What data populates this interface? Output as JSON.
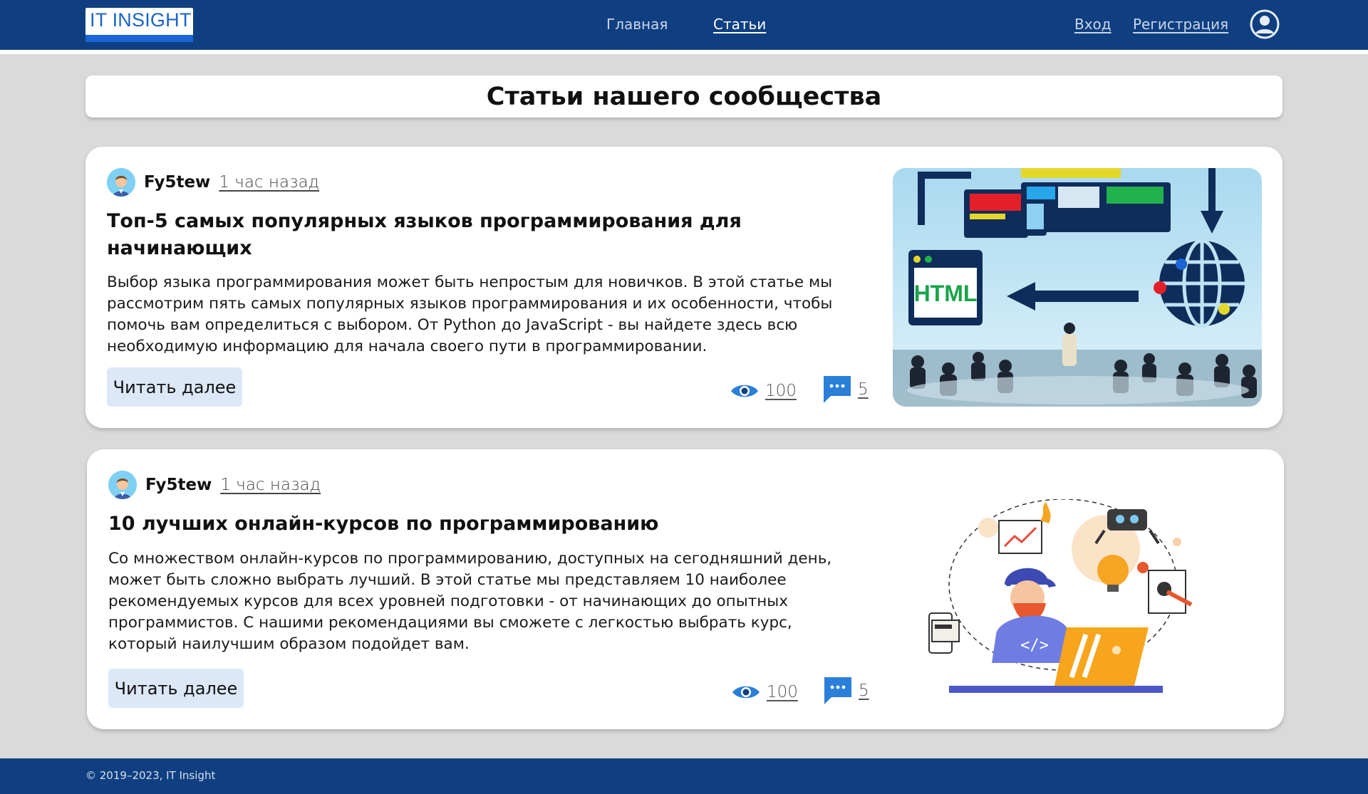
{
  "header": {
    "logo_text": "IT INSIGHT",
    "nav": {
      "home": "Главная",
      "articles": "Статьи"
    },
    "auth": {
      "login": "Вход",
      "register": "Регистрация"
    }
  },
  "page_title": "Статьи нашего сообщества",
  "articles": [
    {
      "author": "Fy5tew",
      "time": "1 час назад",
      "title": "Топ-5 самых популярных языков программирования для начинающих",
      "text": "Выбор языка программирования может быть непростым для новичков. В этой статье мы рассмотрим пять самых популярных языков программирования и их особенности, чтобы помочь вам определиться с выбором. От Python до JavaScript - вы найдете здесь всю необходимую информацию для начала своего пути в программировании.",
      "read_more": "Читать далее",
      "views": "100",
      "comments": "5",
      "image_label": "HTML"
    },
    {
      "author": "Fy5tew",
      "time": "1 час назад",
      "title": "10 лучших онлайн-курсов по программированию",
      "text": "Со множеством онлайн-курсов по программированию, доступных на сегодняшний день, может быть сложно выбрать лучший. В этой статье мы представляем 10 наиболее рекомендуемых курсов для всех уровней подготовки - от начинающих до опытных программистов. С нашими рекомендациями вы сможете с легкостью выбрать курс, который наилучшим образом подойдет вам.",
      "read_more": "Читать далее",
      "views": "100",
      "comments": "5",
      "image_label": "</>"
    }
  ],
  "footer": {
    "copyright": "© 2019–2023, IT Insight"
  },
  "colors": {
    "header_bg": "#0f3f80",
    "page_bg": "#dadada",
    "button_bg": "#dce8f8",
    "accent": "#1a64d6"
  },
  "icons": [
    "user-icon",
    "eye-icon",
    "comment-icon"
  ]
}
